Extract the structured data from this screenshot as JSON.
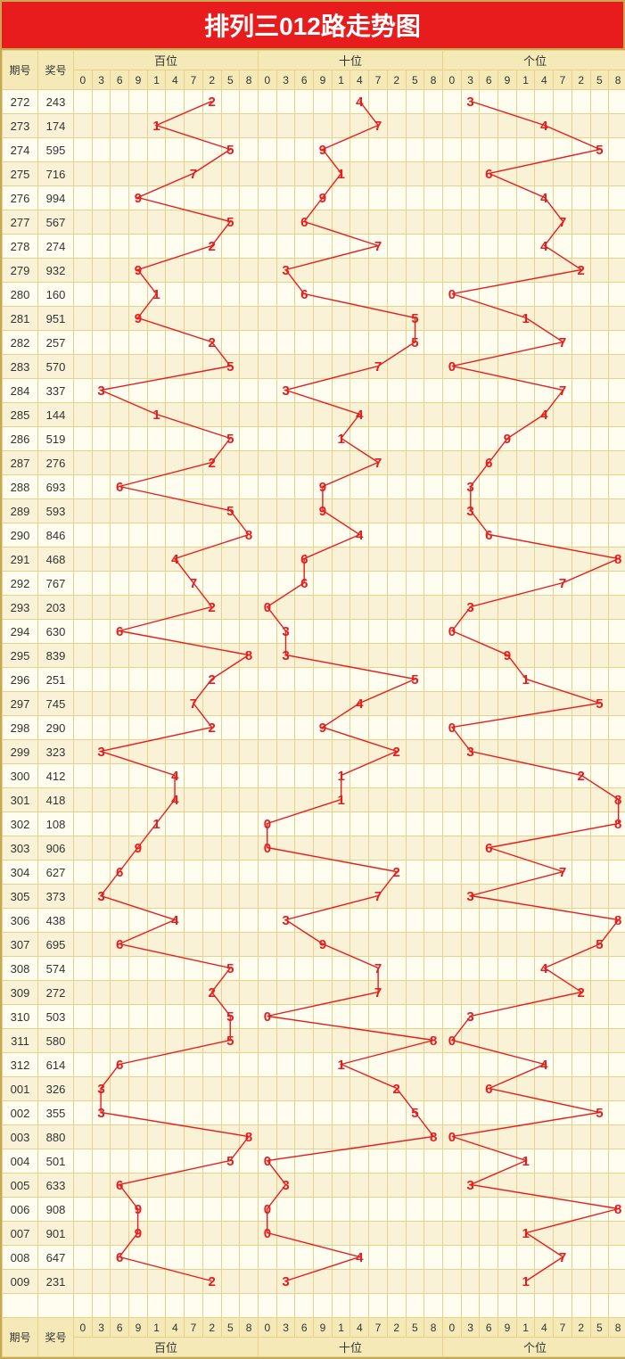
{
  "title": "排列三012路走势图",
  "header": {
    "issue": "期号",
    "number": "奖号",
    "groups": [
      "百位",
      "十位",
      "个位"
    ],
    "digits": [
      "0",
      "3",
      "6",
      "9",
      "1",
      "4",
      "7",
      "2",
      "5",
      "8"
    ]
  },
  "chart_data": {
    "type": "table",
    "title": "排列三012路走势图",
    "digit_order": [
      0,
      3,
      6,
      9,
      1,
      4,
      7,
      2,
      5,
      8
    ],
    "rows": [
      {
        "issue": "272",
        "num": "243",
        "h": 2,
        "t": 4,
        "u": 3
      },
      {
        "issue": "273",
        "num": "174",
        "h": 1,
        "t": 7,
        "u": 4
      },
      {
        "issue": "274",
        "num": "595",
        "h": 5,
        "t": 9,
        "u": 5
      },
      {
        "issue": "275",
        "num": "716",
        "h": 7,
        "t": 1,
        "u": 6
      },
      {
        "issue": "276",
        "num": "994",
        "h": 9,
        "t": 9,
        "u": 4
      },
      {
        "issue": "277",
        "num": "567",
        "h": 5,
        "t": 6,
        "u": 7
      },
      {
        "issue": "278",
        "num": "274",
        "h": 2,
        "t": 7,
        "u": 4
      },
      {
        "issue": "279",
        "num": "932",
        "h": 9,
        "t": 3,
        "u": 2
      },
      {
        "issue": "280",
        "num": "160",
        "h": 1,
        "t": 6,
        "u": 0
      },
      {
        "issue": "281",
        "num": "951",
        "h": 9,
        "t": 5,
        "u": 1
      },
      {
        "issue": "282",
        "num": "257",
        "h": 2,
        "t": 5,
        "u": 7
      },
      {
        "issue": "283",
        "num": "570",
        "h": 5,
        "t": 7,
        "u": 0
      },
      {
        "issue": "284",
        "num": "337",
        "h": 3,
        "t": 3,
        "u": 7
      },
      {
        "issue": "285",
        "num": "144",
        "h": 1,
        "t": 4,
        "u": 4
      },
      {
        "issue": "286",
        "num": "519",
        "h": 5,
        "t": 1,
        "u": 9
      },
      {
        "issue": "287",
        "num": "276",
        "h": 2,
        "t": 7,
        "u": 6
      },
      {
        "issue": "288",
        "num": "693",
        "h": 6,
        "t": 9,
        "u": 3
      },
      {
        "issue": "289",
        "num": "593",
        "h": 5,
        "t": 9,
        "u": 3
      },
      {
        "issue": "290",
        "num": "846",
        "h": 8,
        "t": 4,
        "u": 6
      },
      {
        "issue": "291",
        "num": "468",
        "h": 4,
        "t": 6,
        "u": 8
      },
      {
        "issue": "292",
        "num": "767",
        "h": 7,
        "t": 6,
        "u": 7
      },
      {
        "issue": "293",
        "num": "203",
        "h": 2,
        "t": 0,
        "u": 3
      },
      {
        "issue": "294",
        "num": "630",
        "h": 6,
        "t": 3,
        "u": 0
      },
      {
        "issue": "295",
        "num": "839",
        "h": 8,
        "t": 3,
        "u": 9
      },
      {
        "issue": "296",
        "num": "251",
        "h": 2,
        "t": 5,
        "u": 1
      },
      {
        "issue": "297",
        "num": "745",
        "h": 7,
        "t": 4,
        "u": 5
      },
      {
        "issue": "298",
        "num": "290",
        "h": 2,
        "t": 9,
        "u": 0
      },
      {
        "issue": "299",
        "num": "323",
        "h": 3,
        "t": 2,
        "u": 3
      },
      {
        "issue": "300",
        "num": "412",
        "h": 4,
        "t": 1,
        "u": 2
      },
      {
        "issue": "301",
        "num": "418",
        "h": 4,
        "t": 1,
        "u": 8
      },
      {
        "issue": "302",
        "num": "108",
        "h": 1,
        "t": 0,
        "u": 8
      },
      {
        "issue": "303",
        "num": "906",
        "h": 9,
        "t": 0,
        "u": 6
      },
      {
        "issue": "304",
        "num": "627",
        "h": 6,
        "t": 2,
        "u": 7
      },
      {
        "issue": "305",
        "num": "373",
        "h": 3,
        "t": 7,
        "u": 3
      },
      {
        "issue": "306",
        "num": "438",
        "h": 4,
        "t": 3,
        "u": 8
      },
      {
        "issue": "307",
        "num": "695",
        "h": 6,
        "t": 9,
        "u": 5
      },
      {
        "issue": "308",
        "num": "574",
        "h": 5,
        "t": 7,
        "u": 4
      },
      {
        "issue": "309",
        "num": "272",
        "h": 2,
        "t": 7,
        "u": 2
      },
      {
        "issue": "310",
        "num": "503",
        "h": 5,
        "t": 0,
        "u": 3
      },
      {
        "issue": "311",
        "num": "580",
        "h": 5,
        "t": 8,
        "u": 0
      },
      {
        "issue": "312",
        "num": "614",
        "h": 6,
        "t": 1,
        "u": 4
      },
      {
        "issue": "001",
        "num": "326",
        "h": 3,
        "t": 2,
        "u": 6
      },
      {
        "issue": "002",
        "num": "355",
        "h": 3,
        "t": 5,
        "u": 5
      },
      {
        "issue": "003",
        "num": "880",
        "h": 8,
        "t": 8,
        "u": 0
      },
      {
        "issue": "004",
        "num": "501",
        "h": 5,
        "t": 0,
        "u": 1
      },
      {
        "issue": "005",
        "num": "633",
        "h": 6,
        "t": 3,
        "u": 3
      },
      {
        "issue": "006",
        "num": "908",
        "h": 9,
        "t": 0,
        "u": 8
      },
      {
        "issue": "007",
        "num": "901",
        "h": 9,
        "t": 0,
        "u": 1
      },
      {
        "issue": "008",
        "num": "647",
        "h": 6,
        "t": 4,
        "u": 7
      },
      {
        "issue": "009",
        "num": "231",
        "h": 2,
        "t": 3,
        "u": 1
      }
    ]
  }
}
